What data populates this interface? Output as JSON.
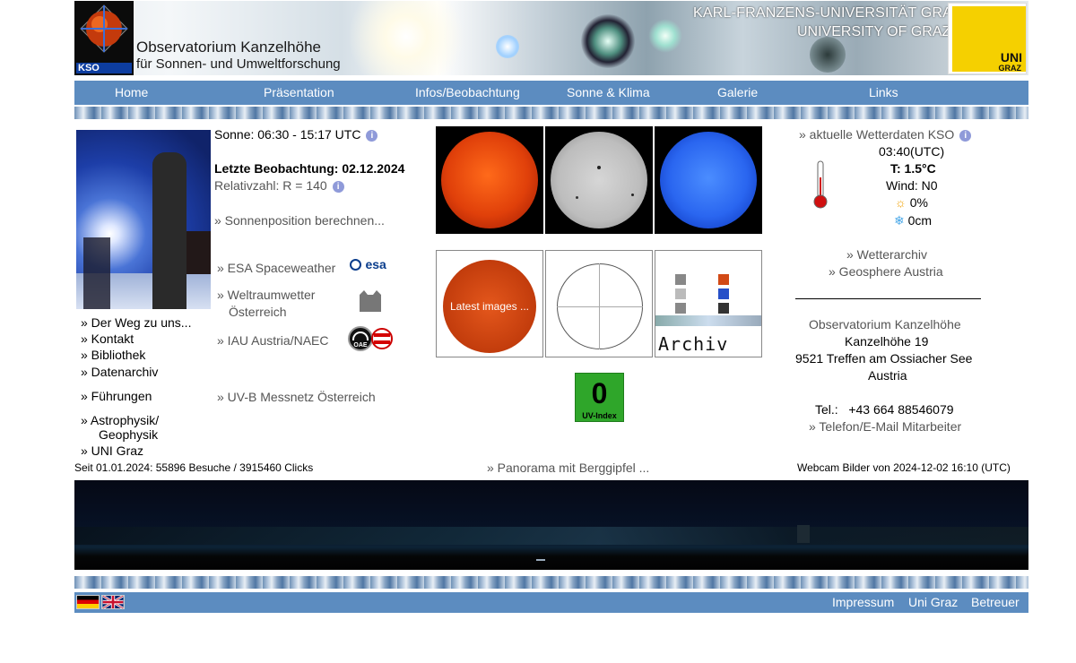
{
  "banner": {
    "kso_label": "KSO",
    "title_line1": "Observatorium Kanzelhöhe",
    "title_line2": "für Sonnen- und Umweltforschung",
    "uni_line1": "KARL-FRANZENS-UNIVERSITÄT GRAZ",
    "uni_line2": "UNIVERSITY OF GRAZ",
    "uni_logo_top": "UNI",
    "uni_logo_bottom": "GRAZ"
  },
  "nav": {
    "items": [
      "Home",
      "Präsentation",
      "Infos/Beobachtung",
      "Sonne & Klima",
      "Galerie",
      "Links"
    ]
  },
  "left": {
    "links": [
      "» Der Weg zu uns...",
      "» Kontakt",
      "» Bibliothek",
      "» Datenarchiv",
      "» Führungen",
      "» Astrophysik/",
      "Geophysik",
      "» UNI Graz"
    ]
  },
  "middle": {
    "sun_times": "Sonne: 06:30 - 15:17 UTC",
    "last_observation": "Letzte Beobachtung: 02.12.2024",
    "relative_number": "Relativzahl: R = 140",
    "sun_position_link": "» Sonnenposition berechnen...",
    "esa_link": "» ESA Spaceweather",
    "esa_logo": "esa",
    "space_weather_link_1": "» Weltraumwetter",
    "space_weather_link_2": "Österreich",
    "iau_link": "» IAU Austria/NAEC",
    "oae_logo": "OAE",
    "uvb_link": "» UV-B Messnetz Österreich",
    "latest_images": "Latest images ...",
    "archive": "Archiv ...",
    "uv_index_value": "0",
    "uv_index_label": "UV-Index"
  },
  "right": {
    "weather_link": "» aktuelle Wetterdaten KSO",
    "time": "03:40(UTC)",
    "temperature": "T: 1.5°C",
    "wind": "Wind: N0",
    "sun_percent": "0%",
    "snow": "0cm",
    "weather_archive": "» Wetterarchiv",
    "geosphere": "» Geosphere Austria",
    "org_name": "Observatorium Kanzelhöhe",
    "address1": "Kanzelhöhe 19",
    "address2": "9521 Treffen am Ossiacher See",
    "country": "Austria",
    "phone": "Tel.:   +43 664 88546079",
    "staff_link": "» Telefon/E-Mail Mitarbeiter"
  },
  "bottom": {
    "visits": "Seit 01.01.2024: 55896 Besuche / 3915460 Clicks",
    "panorama_link": "» Panorama mit Berggipfel ...",
    "webcam_caption": "Webcam Bilder von 2024-12-02 16:10 (UTC)"
  },
  "footer": {
    "links": [
      "Impressum",
      "Uni Graz",
      "Betreuer"
    ]
  },
  "colors": {
    "nav_blue": "#5c8cc0",
    "link_gray": "#555555",
    "uv_green": "#2fa62a"
  }
}
